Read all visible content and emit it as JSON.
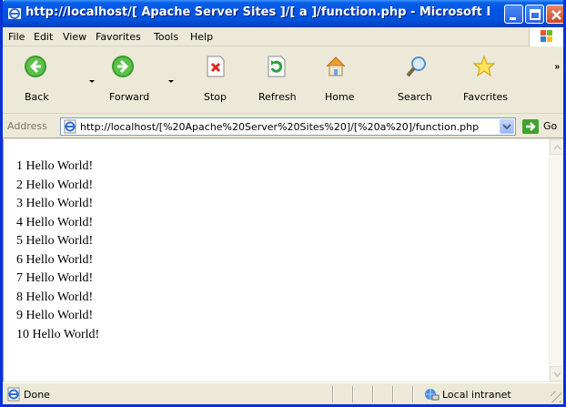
{
  "window": {
    "title": "http://localhost/[ Apache Server Sites ]/[ a ]/function.php - Microsoft Int..."
  },
  "menu": [
    "File",
    "Edit",
    "View",
    "Favorites",
    "Tools",
    "Help"
  ],
  "toolbar": {
    "back": "Back",
    "forward": "Forward",
    "stop": "Stop",
    "refresh": "Refresh",
    "home": "Home",
    "search": "Search",
    "favorites": "Favcrites"
  },
  "address": {
    "label": "Address",
    "url": "http://localhost/[%20Apache%20Server%20Sites%20]/[%20a%20]/function.php",
    "go": "Go"
  },
  "content": {
    "lines": [
      "1 Hello World!",
      "2 Hello World!",
      "3 Hello World!",
      "4 Hello World!",
      "5 Hello World!",
      "6 Hello World!",
      "7 Hello World!",
      "8 Hello World!",
      "9 Hello World!",
      "10 Hello World!"
    ]
  },
  "status": {
    "text": "Done",
    "zone": "Local intranet"
  },
  "colors": {
    "titlebar": "#0054e3",
    "frame": "#0831d9",
    "chrome": "#ece9d8"
  }
}
